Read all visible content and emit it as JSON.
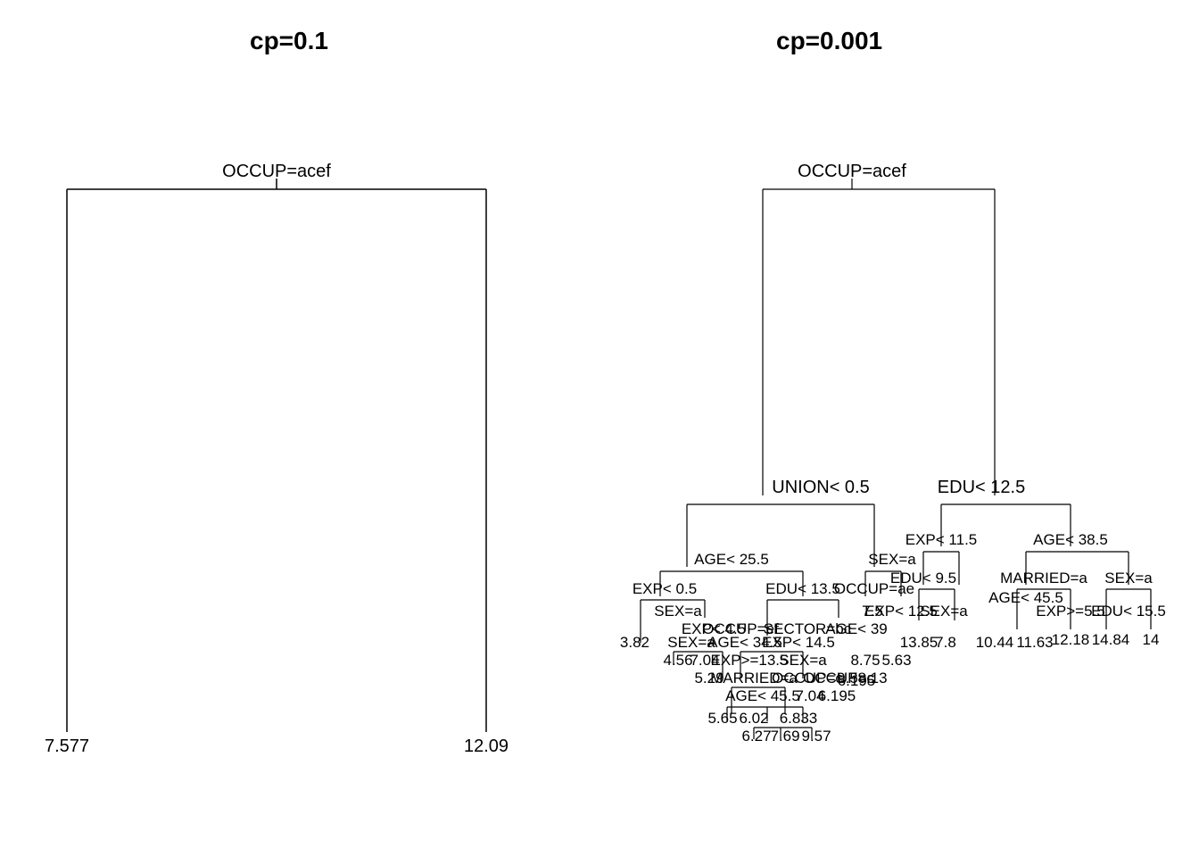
{
  "chart_data": [
    {
      "type": "tree",
      "title": "cp=0.1",
      "root_split": "OCCUP=acef",
      "leaves": [
        "7.577",
        "12.09"
      ]
    },
    {
      "type": "tree",
      "title": "cp=0.001",
      "root_split": "OCCUP=acef",
      "splits_level2": [
        "UNION< 0.5",
        "EDU< 12.5"
      ],
      "splits_level3": [
        "AGE< 25.5",
        "SEX=a",
        "EXP< 11.5",
        "AGE< 38.5"
      ],
      "splits_level4": [
        "EXP< 0.5",
        "EDU< 13.5",
        "OCCUP=ae",
        "EDU< 9.5",
        "MARRIED=a",
        "SEX=a"
      ],
      "splits_level5": [
        "SEX=a",
        "EXP< 4.5",
        "OCCUP=ef",
        "SECTOR=bc",
        "AGE< 39",
        "7.5",
        "EXP< 12.5",
        "SEX=a",
        "EXP>=5.5",
        "EDU< 15.5",
        "AGE< 45.5"
      ],
      "splits_level6": [
        "3.82",
        "SEX=a",
        "AGE< 34.5",
        "EXP< 14.5",
        "OCCUP=c",
        "13.85",
        "7.8",
        "10.44",
        "11.63",
        "12.18",
        "14.84",
        "14"
      ],
      "splits_level7": [
        "4.56",
        "7.04",
        "EXP>=13.5",
        "SEX=a",
        "8.75",
        "5.63"
      ],
      "splits_level8": [
        "5.29",
        "MARRIED=a",
        "OCCUP=c",
        "9.5",
        "8.13",
        "6.195"
      ],
      "splits_level9": [
        "AGE< 45.5",
        "7.04",
        "6.195"
      ],
      "leaves_bottom": [
        "5.65",
        "6.02",
        "6.833",
        "6.27",
        "7.69",
        "9.57"
      ]
    }
  ],
  "left": {
    "title": "cp=0.1",
    "root": "OCCUP=acef",
    "leaf_left": "7.577",
    "leaf_right": "12.09"
  },
  "right": {
    "title": "cp=0.001",
    "root": "OCCUP=acef",
    "s1": "UNION< 0.5",
    "s2": "EDU< 12.5",
    "s3": "EXP< 11.5",
    "s3b": "AGE< 38.5",
    "s4": "AGE< 25.5",
    "s5": "SEX=a",
    "s6": "EXP< 0.5",
    "s7": "EDU< 13.5",
    "s8": "EDU< 9.5",
    "s8b": "MARRIED=a",
    "s8c": "SEX=a",
    "s9": "OCCUP=ae",
    "s10": "SEX=a",
    "s11": "EXP< 4.5",
    "s12": "OCCUP=ef",
    "s13": "SECTOR=bc",
    "s14": "AGE< 39",
    "s15": "EXP< 12.5",
    "s16": "SEX=a",
    "s16b": "EXP>=5.5",
    "s17": "EDU< 15.5",
    "s18": "AGE< 45.5",
    "s19": "SEX=a",
    "s20": "AGE< 34.5",
    "s21": "EXP< 14.5",
    "s22": "EXP>=13.5",
    "s23": "SEX=a",
    "s24": "MARRIED=a",
    "s25": "OCCUP=c",
    "s25b": "OCCUP=c",
    "s26": "AGE< 45.5",
    "l1": "3.82",
    "l2": "4.56",
    "l2b": "7.04",
    "l3": "5.29",
    "l4": "7.5",
    "l5": "13.85",
    "l6": "7.8",
    "l7": "10.44",
    "l8": "11.63",
    "l9": "12.18",
    "l10": "14.84",
    "l11": "14",
    "l12": "8.75",
    "l13": "5.63",
    "l14": "9.5",
    "l14b": "8.13",
    "l15": "6.195",
    "l15b": "7.04",
    "l15c": "6.195",
    "l16": "5.65",
    "l17": "6.02",
    "l18": "6.833",
    "l19": "6.27",
    "l20": "7.69",
    "l21": "9.57"
  }
}
